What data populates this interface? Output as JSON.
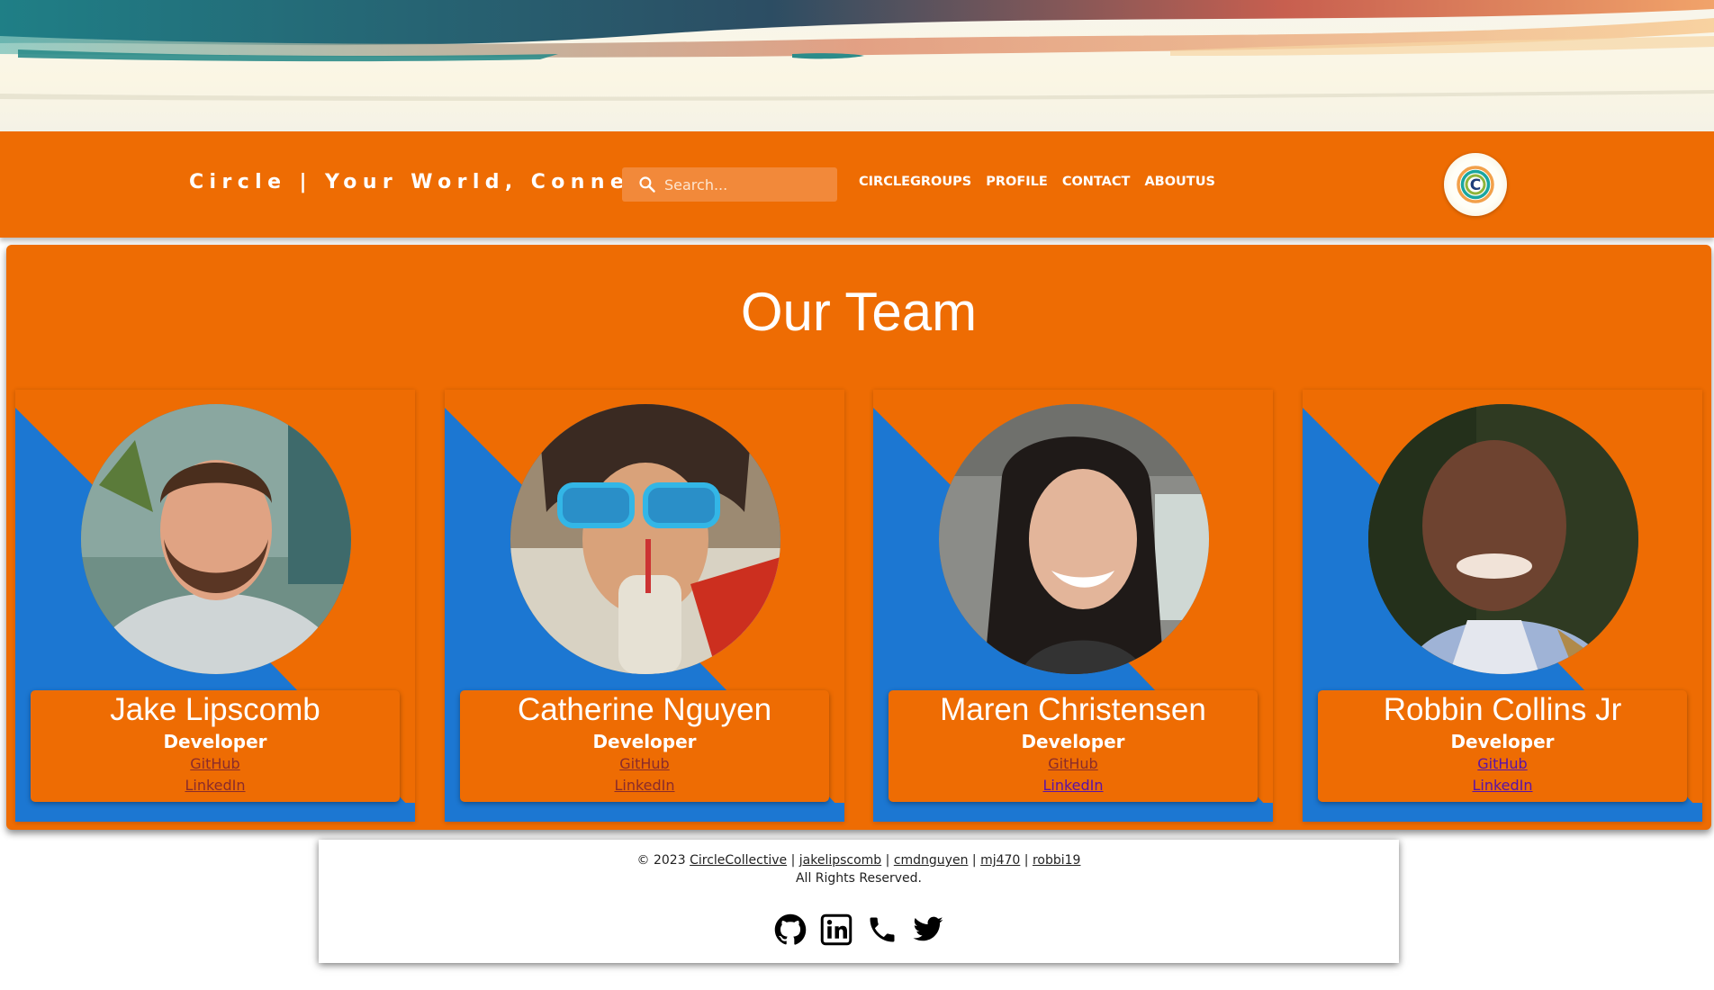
{
  "header": {
    "brand": "Circle | Your World, Connected",
    "search_placeholder": "Search...",
    "nav": [
      "CIRCLEGROUPS",
      "PROFILE",
      "CONTACT",
      "ABOUTUS"
    ]
  },
  "team": {
    "title": "Our Team",
    "members": [
      {
        "name": "Jake Lipscomb",
        "role": "Developer",
        "github": "GitHub",
        "linkedin": "LinkedIn"
      },
      {
        "name": "Catherine Nguyen",
        "role": "Developer",
        "github": "GitHub",
        "linkedin": "LinkedIn"
      },
      {
        "name": "Maren Christensen",
        "role": "Developer",
        "github": "GitHub",
        "linkedin": "LinkedIn"
      },
      {
        "name": "Robbin Collins Jr",
        "role": "Developer",
        "github": "GitHub",
        "linkedin": "LinkedIn"
      }
    ]
  },
  "footer": {
    "copyright_prefix": "© 2023",
    "links": [
      "CircleCollective",
      "jakelipscomb",
      "cmdnguyen",
      "mj470",
      "robbi19"
    ],
    "separator": "|",
    "rights": "All Rights Reserved.",
    "social_icons": [
      "github-icon",
      "linkedin-icon",
      "phone-icon",
      "twitter-icon"
    ]
  },
  "colors": {
    "primary_orange": "#ee6c03",
    "accent_blue": "#1c77d2"
  }
}
